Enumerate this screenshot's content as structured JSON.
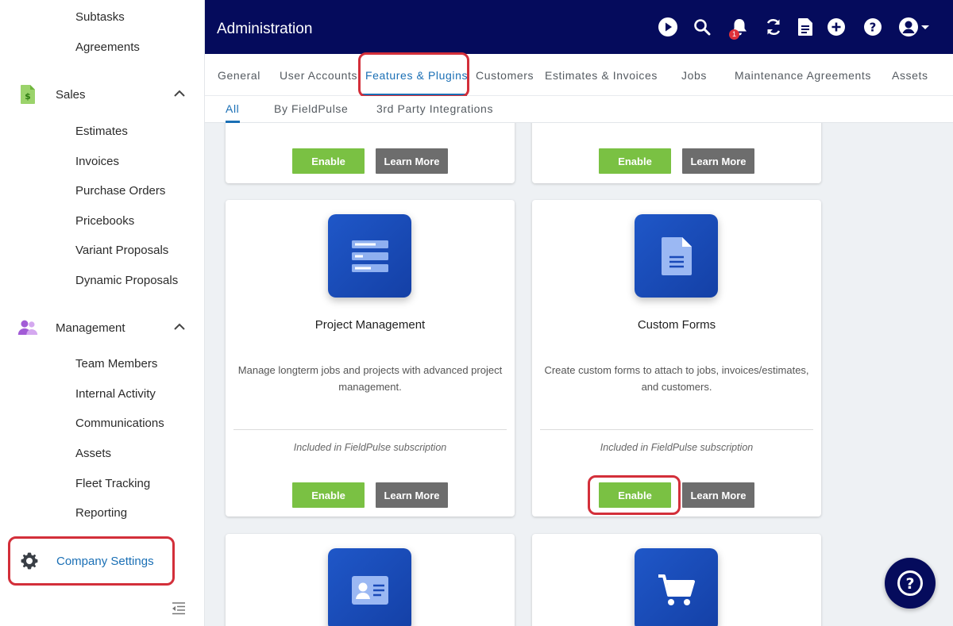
{
  "sidebar": {
    "top_items": [
      {
        "label": "Subtasks"
      },
      {
        "label": "Agreements"
      }
    ],
    "sales": {
      "label": "Sales",
      "items": [
        {
          "label": "Estimates"
        },
        {
          "label": "Invoices"
        },
        {
          "label": "Purchase Orders"
        },
        {
          "label": "Pricebooks"
        },
        {
          "label": "Variant Proposals"
        },
        {
          "label": "Dynamic Proposals"
        }
      ]
    },
    "management": {
      "label": "Management",
      "items": [
        {
          "label": "Team Members"
        },
        {
          "label": "Internal Activity"
        },
        {
          "label": "Communications"
        },
        {
          "label": "Assets"
        },
        {
          "label": "Fleet Tracking"
        },
        {
          "label": "Reporting"
        }
      ]
    },
    "company_settings": {
      "label": "Company Settings"
    }
  },
  "header": {
    "title": "Administration",
    "notification_count": "1",
    "icons": [
      "play-icon",
      "search-icon",
      "bell-icon",
      "sync-icon",
      "document-icon",
      "add-icon",
      "help-icon",
      "user-account-icon"
    ]
  },
  "tabs": [
    {
      "label": "General"
    },
    {
      "label": "User Accounts"
    },
    {
      "label": "Features & Plugins"
    },
    {
      "label": "Customers"
    },
    {
      "label": "Estimates & Invoices"
    },
    {
      "label": "Jobs"
    },
    {
      "label": "Maintenance Agreements"
    },
    {
      "label": "Assets"
    }
  ],
  "subtabs": [
    {
      "label": "All"
    },
    {
      "label": "By FieldPulse"
    },
    {
      "label": "3rd Party Integrations"
    }
  ],
  "buttons": {
    "enable": "Enable",
    "learn_more": "Learn More"
  },
  "features": [
    {
      "title": "Project Management",
      "description": "Manage longterm jobs and projects with advanced project management.",
      "note": "Included in FieldPulse subscription",
      "icon": "project-list-icon"
    },
    {
      "title": "Custom Forms",
      "description": "Create custom forms to attach to jobs, invoices/estimates, and customers.",
      "note": "Included in FieldPulse subscription",
      "icon": "form-document-icon"
    }
  ],
  "colors": {
    "header_bg": "#050b5c",
    "accent_blue": "#1a6fb5",
    "enable_green": "#7ac143",
    "learn_more_gray": "#6d6d6d",
    "highlight_red": "#d32f3a"
  }
}
